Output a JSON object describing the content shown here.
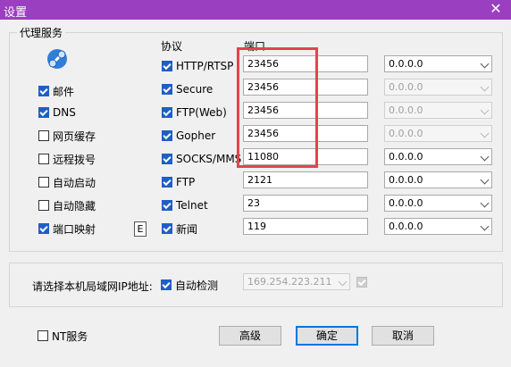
{
  "window": {
    "title": "设置",
    "close_glyph": "✕"
  },
  "proxy_group": {
    "title": "代理服务",
    "protocol_header": "协议",
    "port_header": "端口",
    "left_options": [
      {
        "label": "邮件",
        "checked": true
      },
      {
        "label": "DNS",
        "checked": true
      },
      {
        "label": "网页缓存",
        "checked": false
      },
      {
        "label": "远程拨号",
        "checked": false
      },
      {
        "label": "自动启动",
        "checked": false
      },
      {
        "label": "自动隐藏",
        "checked": false
      },
      {
        "label": "端口映射",
        "checked": true
      }
    ],
    "e_button": "E",
    "rows": [
      {
        "protocol": "HTTP/RTSP",
        "port": "23456",
        "ip": "0.0.0.0",
        "enabled": true
      },
      {
        "protocol": "Secure",
        "port": "23456",
        "ip": "0.0.0.0",
        "enabled": false
      },
      {
        "protocol": "FTP(Web)",
        "port": "23456",
        "ip": "0.0.0.0",
        "enabled": false
      },
      {
        "protocol": "Gopher",
        "port": "23456",
        "ip": "0.0.0.0",
        "enabled": false
      },
      {
        "protocol": "SOCKS/MMS",
        "port": "11080",
        "ip": "0.0.0.0",
        "enabled": true
      },
      {
        "protocol": "FTP",
        "port": "2121",
        "ip": "0.0.0.0",
        "enabled": true
      },
      {
        "protocol": "Telnet",
        "port": "23",
        "ip": "0.0.0.0",
        "enabled": true
      },
      {
        "protocol": "新闻",
        "port": "119",
        "ip": "0.0.0.0",
        "enabled": true
      }
    ]
  },
  "lan_group": {
    "label": "请选择本机局域网IP地址:",
    "auto_detect": "自动检测",
    "ip_value": "169.254.223.211"
  },
  "footer": {
    "nt_service": "NT服务",
    "advanced": "高级",
    "ok": "确定",
    "cancel": "取消"
  },
  "colors": {
    "titlebar": "#9a3fbf",
    "accent": "#1f5fc4",
    "highlight": "#e3434f"
  }
}
